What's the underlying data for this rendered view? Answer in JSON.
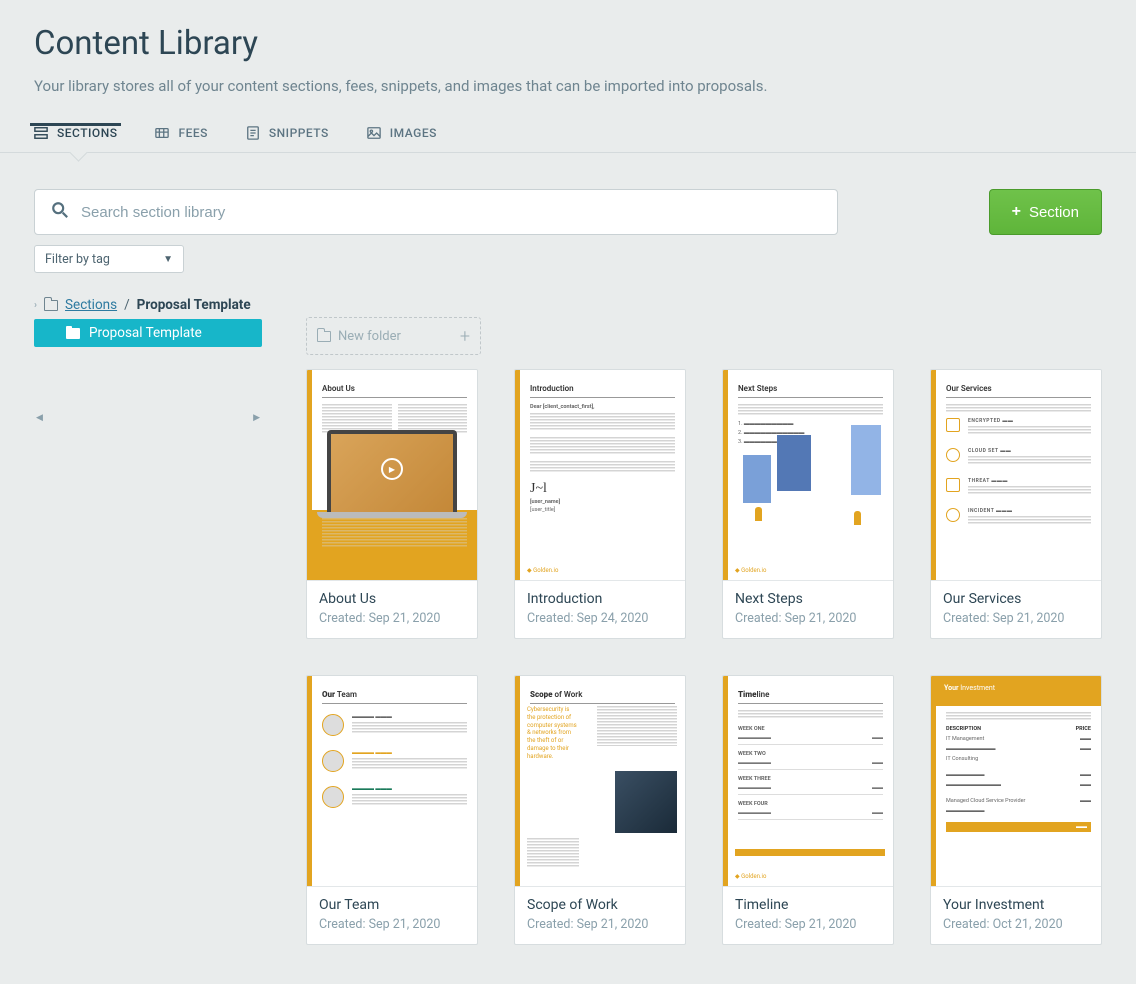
{
  "page": {
    "title": "Content Library",
    "subtitle": "Your library stores all of your content sections, fees, snippets, and images that can be imported into proposals."
  },
  "tabs": [
    {
      "label": "SECTIONS",
      "active": true
    },
    {
      "label": "FEES",
      "active": false
    },
    {
      "label": "SNIPPETS",
      "active": false
    },
    {
      "label": "IMAGES",
      "active": false
    }
  ],
  "search": {
    "placeholder": "Search section library"
  },
  "filter": {
    "label": "Filter by tag"
  },
  "new_button": {
    "label": "Section"
  },
  "breadcrumb": {
    "root": "Sections",
    "current": "Proposal Template"
  },
  "tree": {
    "selected": "Proposal Template"
  },
  "new_folder": {
    "label": "New folder"
  },
  "cards": [
    {
      "title": "About Us",
      "created": "Created: Sep 21, 2020",
      "thumb_title": "About Us"
    },
    {
      "title": "Introduction",
      "created": "Created: Sep 24, 2020",
      "thumb_title": "Introduction"
    },
    {
      "title": "Next Steps",
      "created": "Created: Sep 21, 2020",
      "thumb_title": "Next Steps"
    },
    {
      "title": "Our Services",
      "created": "Created: Sep 21, 2020",
      "thumb_title": "Our Services"
    },
    {
      "title": "Our Team",
      "created": "Created: Sep 21, 2020",
      "thumb_title": "Our Team"
    },
    {
      "title": "Scope of Work",
      "created": "Created: Sep 21, 2020",
      "thumb_title": "Scope of Work"
    },
    {
      "title": "Timeline",
      "created": "Created: Sep 21, 2020",
      "thumb_title": "Timeline"
    },
    {
      "title": "Your Investment",
      "created": "Created: Oct 21, 2020",
      "thumb_title": "Your Investment"
    }
  ]
}
